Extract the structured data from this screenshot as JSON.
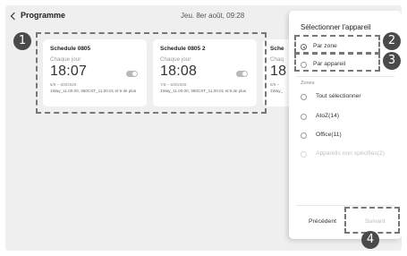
{
  "header": {
    "back_label": "Programme",
    "datetime": "Jeu. 8er août, 09:28"
  },
  "schedules": [
    {
      "title": "Schedule 0805",
      "repeat": "Chaque jour",
      "time": "18:07",
      "dates": "5/8 – 5/8/2025",
      "devices": "1Way_11.00.00, 360CST_11.00.01 et 9 de plus",
      "enabled": false
    },
    {
      "title": "Schedule 0805 2",
      "repeat": "Chaque jour",
      "time": "18:08",
      "dates": "7/8 – 5/8/2025",
      "devices": "1Way_11.00.00, 360CST_11.00.01 et 9 de plus",
      "enabled": false
    },
    {
      "title": "Sche",
      "repeat": "Chaq",
      "time": "18",
      "dates": "8/8 –",
      "devices": "1Way_"
    }
  ],
  "panel": {
    "title": "Sélectionner l'appareil",
    "modes": [
      {
        "label": "Par zone",
        "selected": true
      },
      {
        "label": "Par appareil",
        "selected": false
      }
    ],
    "zones_heading": "Zones",
    "zones": [
      {
        "label": "Tout sélectionner",
        "disabled": false
      },
      {
        "label": "AtoZ(14)",
        "disabled": false
      },
      {
        "label": "Office(11)",
        "disabled": false
      },
      {
        "label": "Appareils non spécifiés(2)",
        "disabled": true
      }
    ],
    "previous_label": "Précédent",
    "next_label": "Suivant"
  },
  "markers": [
    "1",
    "2",
    "3",
    "4"
  ],
  "colors": {
    "background": "#efefef",
    "card": "#ffffff",
    "marker": "#4a4a4a",
    "disabled_text": "#c0c0c0"
  }
}
